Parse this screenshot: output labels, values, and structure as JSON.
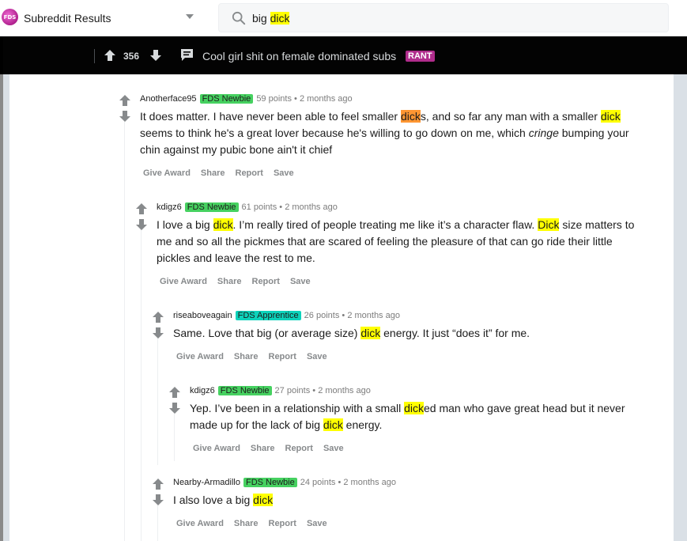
{
  "header": {
    "logo_text": "FDS",
    "subreddit_results_label": "Subreddit Results",
    "search": {
      "query_plain": "big ",
      "query_highlight": "dick"
    }
  },
  "post": {
    "score": "356",
    "title": "Cool girl shit on female dominated subs",
    "flair": "RANT"
  },
  "comments": [
    {
      "user": "Anotherface95",
      "flair": "FDS Newbie",
      "points": "59 points",
      "sep": "•",
      "age": "2 months ago",
      "body": {
        "p1": "It does matter. I have never been able to feel smaller ",
        "h1": "dick",
        "p2": "s, and so far any man with a smaller ",
        "h2": "dick",
        "p3": " seems to think he's a great lover because he's willing to go down on me, which ",
        "em": "cringe",
        "p4": " bumping your chin against my pubic bone ain't it chief"
      },
      "actions": [
        "Give Award",
        "Share",
        "Report",
        "Save"
      ]
    },
    {
      "user": "kdigz6",
      "flair": "FDS Newbie",
      "points": "61 points",
      "sep": "•",
      "age": "2 months ago",
      "body": {
        "p1": "I love a big ",
        "h1": "dick",
        "p2": ". I’m really tired of people treating me like it’s a character flaw. ",
        "h2": "Dick",
        "p3": " size matters to me and so all the pickmes that are scared of feeling the pleasure of that can go ride their little pickles and leave the rest to me."
      },
      "actions": [
        "Give Award",
        "Share",
        "Report",
        "Save"
      ]
    },
    {
      "user": "riseaboveagain",
      "flair": "FDS Apprentice",
      "points": "26 points",
      "sep": "•",
      "age": "2 months ago",
      "body": {
        "p1": "Same. Love that big (or average size) ",
        "h1": "dick",
        "p2": " energy. It just “does it” for me."
      },
      "actions": [
        "Give Award",
        "Share",
        "Report",
        "Save"
      ]
    },
    {
      "user": "kdigz6",
      "flair": "FDS Newbie",
      "points": "27 points",
      "sep": "•",
      "age": "2 months ago",
      "body": {
        "p1": "Yep. I’ve been in a relationship with a small ",
        "h1": "dick",
        "p2": "ed man who gave great head but it never made up for the lack of big ",
        "h2": "dick",
        "p3": " energy."
      },
      "actions": [
        "Give Award",
        "Share",
        "Report",
        "Save"
      ]
    },
    {
      "user": "Nearby-Armadillo",
      "flair": "FDS Newbie",
      "points": "24 points",
      "sep": "•",
      "age": "2 months ago",
      "body": {
        "p1": "I also love a big ",
        "h1": "dick"
      },
      "actions": [
        "Give Award",
        "Share",
        "Report",
        "Save"
      ]
    }
  ],
  "colors": {
    "highlight": "#ffff00",
    "current_highlight": "#ff9632",
    "flair_newbie": "#46d160",
    "flair_apprentice": "#0dd3bb",
    "rant_flair": "#b02c8c"
  }
}
